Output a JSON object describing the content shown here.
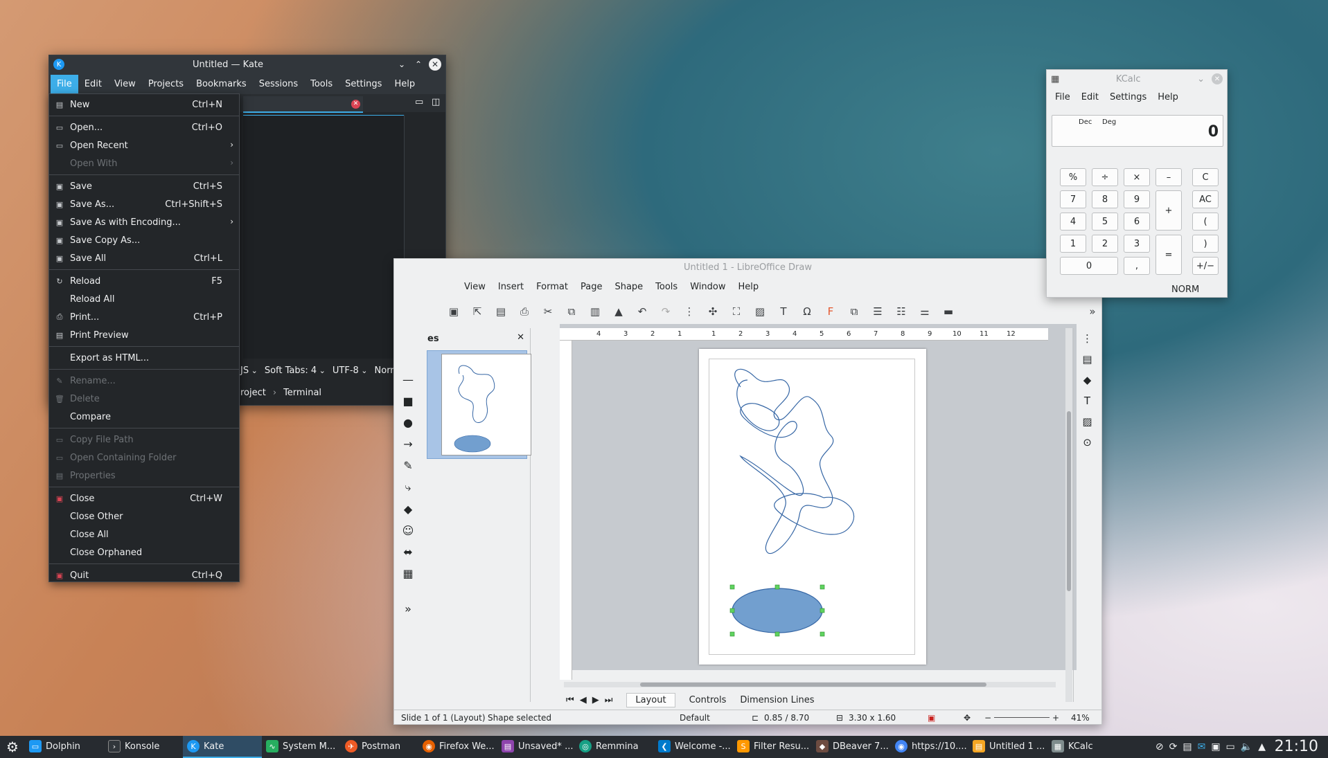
{
  "kate": {
    "title": "Untitled — Kate",
    "menu": [
      "File",
      "Edit",
      "View",
      "Projects",
      "Bookmarks",
      "Sessions",
      "Tools",
      "Settings",
      "Help"
    ],
    "status": {
      "lang": "JS",
      "tabs": "Soft Tabs: 4",
      "encoding": "UTF-8",
      "mode": "Norma"
    },
    "bottom": {
      "project": "roject",
      "terminal": "Terminal"
    }
  },
  "file_menu": {
    "items": [
      {
        "label": "New",
        "shortcut": "Ctrl+N",
        "icon": "new-icon"
      },
      {
        "label": "Open...",
        "shortcut": "Ctrl+O",
        "icon": "open-icon"
      },
      {
        "label": "Open Recent",
        "shortcut": "",
        "icon": "open-recent-icon"
      },
      {
        "label": "Open With",
        "shortcut": "",
        "icon": ""
      },
      {
        "label": "Save",
        "shortcut": "Ctrl+S",
        "icon": "save-icon"
      },
      {
        "label": "Save As...",
        "shortcut": "Ctrl+Shift+S",
        "icon": "save-as-icon"
      },
      {
        "label": "Save As with Encoding...",
        "shortcut": "",
        "icon": "save-encoding-icon"
      },
      {
        "label": "Save Copy As...",
        "shortcut": "",
        "icon": "save-copy-icon"
      },
      {
        "label": "Save All",
        "shortcut": "Ctrl+L",
        "icon": "save-all-icon"
      },
      {
        "label": "Reload",
        "shortcut": "F5",
        "icon": "reload-icon"
      },
      {
        "label": "Reload All",
        "shortcut": "",
        "icon": ""
      },
      {
        "label": "Print...",
        "shortcut": "Ctrl+P",
        "icon": "print-icon"
      },
      {
        "label": "Print Preview",
        "shortcut": "",
        "icon": "print-preview-icon"
      },
      {
        "label": "Export as HTML...",
        "shortcut": "",
        "icon": ""
      },
      {
        "label": "Rename...",
        "shortcut": "",
        "icon": "rename-icon"
      },
      {
        "label": "Delete",
        "shortcut": "",
        "icon": "delete-icon"
      },
      {
        "label": "Compare",
        "shortcut": "",
        "icon": ""
      },
      {
        "label": "Copy File Path",
        "shortcut": "",
        "icon": "copy-path-icon"
      },
      {
        "label": "Open Containing Folder",
        "shortcut": "",
        "icon": "folder-icon"
      },
      {
        "label": "Properties",
        "shortcut": "",
        "icon": "properties-icon"
      },
      {
        "label": "Close",
        "shortcut": "Ctrl+W",
        "icon": "close-doc-icon"
      },
      {
        "label": "Close Other",
        "shortcut": "",
        "icon": ""
      },
      {
        "label": "Close All",
        "shortcut": "",
        "icon": ""
      },
      {
        "label": "Close Orphaned",
        "shortcut": "",
        "icon": ""
      },
      {
        "label": "Quit",
        "shortcut": "Ctrl+Q",
        "icon": "quit-icon"
      }
    ]
  },
  "kcalc": {
    "title": "KCalc",
    "menu": [
      "File",
      "Edit",
      "Settings",
      "Help"
    ],
    "display": {
      "dec": "Dec",
      "deg": "Deg",
      "value": "0"
    },
    "buttons": {
      "percent": "%",
      "divide": "÷",
      "multiply": "×",
      "minus": "–",
      "clear": "C",
      "seven": "7",
      "eight": "8",
      "nine": "9",
      "plus": "+",
      "allclear": "AC",
      "four": "4",
      "five": "5",
      "six": "6",
      "lparen": "(",
      "one": "1",
      "two": "2",
      "three": "3",
      "equals": "=",
      "rparen": ")",
      "zero": "0",
      "decimal": ",",
      "sign": "+/−"
    },
    "mode": "NORM"
  },
  "draw": {
    "title": "Untitled 1 - LibreOffice Draw",
    "menu": [
      "View",
      "Insert",
      "Format",
      "Page",
      "Shape",
      "Tools",
      "Window",
      "Help"
    ],
    "pages_title": "es",
    "ruler_ticks": [
      "4",
      "3",
      "2",
      "1",
      "1",
      "2",
      "3",
      "4",
      "5",
      "6",
      "7",
      "8",
      "9",
      "10",
      "11",
      "12"
    ],
    "tabs": [
      "Layout",
      "Controls",
      "Dimension Lines"
    ],
    "status": {
      "slide": "Slide 1 of 1 (Layout)",
      "selection": "Shape selected",
      "style": "Default",
      "position": "0.85 / 8.70",
      "size": "3.30 x 1.60",
      "zoom": "41%"
    },
    "shape_fill": "#729fcf",
    "curve_color": "#3465a4"
  },
  "taskbar": {
    "tasks": [
      {
        "label": "Dolphin",
        "color": "#1d99f3"
      },
      {
        "label": "Konsole",
        "color": "#31363b"
      },
      {
        "label": "Kate",
        "color": "#1d99f3"
      },
      {
        "label": "System M...",
        "color": "#27ae60"
      },
      {
        "label": "Postman",
        "color": "#ef5b25"
      },
      {
        "label": "Firefox We...",
        "color": "#e66000"
      },
      {
        "label": "Unsaved* ...",
        "color": "#8e44ad"
      },
      {
        "label": "Remmina",
        "color": "#16a085"
      },
      {
        "label": "Welcome -...",
        "color": "#007acc"
      },
      {
        "label": "Filter Resu...",
        "color": "#ff9800"
      },
      {
        "label": "DBeaver 7...",
        "color": "#6d4c41"
      },
      {
        "label": "https://10....",
        "color": "#4285f4"
      },
      {
        "label": "Untitled 1 ...",
        "color": "#f5a623"
      },
      {
        "label": "KCalc",
        "color": "#7f8c8d"
      }
    ],
    "clock": "21:10"
  }
}
